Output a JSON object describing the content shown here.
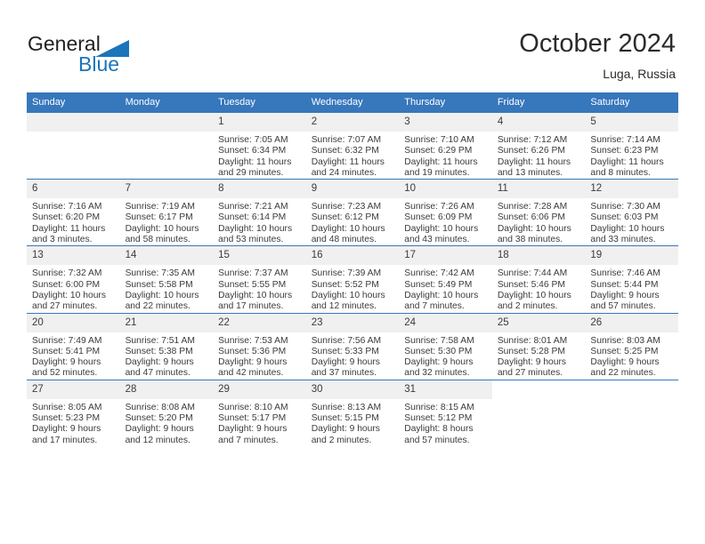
{
  "brand": {
    "name_part1": "General",
    "name_part2": "Blue",
    "accent_color": "#1b75bb"
  },
  "header": {
    "month_title": "October 2024",
    "location": "Luga, Russia"
  },
  "colors": {
    "header_blue": "#3777bc",
    "daynum_band": "#f0f0f0",
    "text": "#3b3b3b"
  },
  "weekdays": [
    "Sunday",
    "Monday",
    "Tuesday",
    "Wednesday",
    "Thursday",
    "Friday",
    "Saturday"
  ],
  "weeks": [
    [
      {
        "day": "",
        "blank": true
      },
      {
        "day": "",
        "blank": true
      },
      {
        "day": "1",
        "sunrise": "Sunrise: 7:05 AM",
        "sunset": "Sunset: 6:34 PM",
        "daylight1": "Daylight: 11 hours",
        "daylight2": "and 29 minutes."
      },
      {
        "day": "2",
        "sunrise": "Sunrise: 7:07 AM",
        "sunset": "Sunset: 6:32 PM",
        "daylight1": "Daylight: 11 hours",
        "daylight2": "and 24 minutes."
      },
      {
        "day": "3",
        "sunrise": "Sunrise: 7:10 AM",
        "sunset": "Sunset: 6:29 PM",
        "daylight1": "Daylight: 11 hours",
        "daylight2": "and 19 minutes."
      },
      {
        "day": "4",
        "sunrise": "Sunrise: 7:12 AM",
        "sunset": "Sunset: 6:26 PM",
        "daylight1": "Daylight: 11 hours",
        "daylight2": "and 13 minutes."
      },
      {
        "day": "5",
        "sunrise": "Sunrise: 7:14 AM",
        "sunset": "Sunset: 6:23 PM",
        "daylight1": "Daylight: 11 hours",
        "daylight2": "and 8 minutes."
      }
    ],
    [
      {
        "day": "6",
        "sunrise": "Sunrise: 7:16 AM",
        "sunset": "Sunset: 6:20 PM",
        "daylight1": "Daylight: 11 hours",
        "daylight2": "and 3 minutes."
      },
      {
        "day": "7",
        "sunrise": "Sunrise: 7:19 AM",
        "sunset": "Sunset: 6:17 PM",
        "daylight1": "Daylight: 10 hours",
        "daylight2": "and 58 minutes."
      },
      {
        "day": "8",
        "sunrise": "Sunrise: 7:21 AM",
        "sunset": "Sunset: 6:14 PM",
        "daylight1": "Daylight: 10 hours",
        "daylight2": "and 53 minutes."
      },
      {
        "day": "9",
        "sunrise": "Sunrise: 7:23 AM",
        "sunset": "Sunset: 6:12 PM",
        "daylight1": "Daylight: 10 hours",
        "daylight2": "and 48 minutes."
      },
      {
        "day": "10",
        "sunrise": "Sunrise: 7:26 AM",
        "sunset": "Sunset: 6:09 PM",
        "daylight1": "Daylight: 10 hours",
        "daylight2": "and 43 minutes."
      },
      {
        "day": "11",
        "sunrise": "Sunrise: 7:28 AM",
        "sunset": "Sunset: 6:06 PM",
        "daylight1": "Daylight: 10 hours",
        "daylight2": "and 38 minutes."
      },
      {
        "day": "12",
        "sunrise": "Sunrise: 7:30 AM",
        "sunset": "Sunset: 6:03 PM",
        "daylight1": "Daylight: 10 hours",
        "daylight2": "and 33 minutes."
      }
    ],
    [
      {
        "day": "13",
        "sunrise": "Sunrise: 7:32 AM",
        "sunset": "Sunset: 6:00 PM",
        "daylight1": "Daylight: 10 hours",
        "daylight2": "and 27 minutes."
      },
      {
        "day": "14",
        "sunrise": "Sunrise: 7:35 AM",
        "sunset": "Sunset: 5:58 PM",
        "daylight1": "Daylight: 10 hours",
        "daylight2": "and 22 minutes."
      },
      {
        "day": "15",
        "sunrise": "Sunrise: 7:37 AM",
        "sunset": "Sunset: 5:55 PM",
        "daylight1": "Daylight: 10 hours",
        "daylight2": "and 17 minutes."
      },
      {
        "day": "16",
        "sunrise": "Sunrise: 7:39 AM",
        "sunset": "Sunset: 5:52 PM",
        "daylight1": "Daylight: 10 hours",
        "daylight2": "and 12 minutes."
      },
      {
        "day": "17",
        "sunrise": "Sunrise: 7:42 AM",
        "sunset": "Sunset: 5:49 PM",
        "daylight1": "Daylight: 10 hours",
        "daylight2": "and 7 minutes."
      },
      {
        "day": "18",
        "sunrise": "Sunrise: 7:44 AM",
        "sunset": "Sunset: 5:46 PM",
        "daylight1": "Daylight: 10 hours",
        "daylight2": "and 2 minutes."
      },
      {
        "day": "19",
        "sunrise": "Sunrise: 7:46 AM",
        "sunset": "Sunset: 5:44 PM",
        "daylight1": "Daylight: 9 hours",
        "daylight2": "and 57 minutes."
      }
    ],
    [
      {
        "day": "20",
        "sunrise": "Sunrise: 7:49 AM",
        "sunset": "Sunset: 5:41 PM",
        "daylight1": "Daylight: 9 hours",
        "daylight2": "and 52 minutes."
      },
      {
        "day": "21",
        "sunrise": "Sunrise: 7:51 AM",
        "sunset": "Sunset: 5:38 PM",
        "daylight1": "Daylight: 9 hours",
        "daylight2": "and 47 minutes."
      },
      {
        "day": "22",
        "sunrise": "Sunrise: 7:53 AM",
        "sunset": "Sunset: 5:36 PM",
        "daylight1": "Daylight: 9 hours",
        "daylight2": "and 42 minutes."
      },
      {
        "day": "23",
        "sunrise": "Sunrise: 7:56 AM",
        "sunset": "Sunset: 5:33 PM",
        "daylight1": "Daylight: 9 hours",
        "daylight2": "and 37 minutes."
      },
      {
        "day": "24",
        "sunrise": "Sunrise: 7:58 AM",
        "sunset": "Sunset: 5:30 PM",
        "daylight1": "Daylight: 9 hours",
        "daylight2": "and 32 minutes."
      },
      {
        "day": "25",
        "sunrise": "Sunrise: 8:01 AM",
        "sunset": "Sunset: 5:28 PM",
        "daylight1": "Daylight: 9 hours",
        "daylight2": "and 27 minutes."
      },
      {
        "day": "26",
        "sunrise": "Sunrise: 8:03 AM",
        "sunset": "Sunset: 5:25 PM",
        "daylight1": "Daylight: 9 hours",
        "daylight2": "and 22 minutes."
      }
    ],
    [
      {
        "day": "27",
        "sunrise": "Sunrise: 8:05 AM",
        "sunset": "Sunset: 5:23 PM",
        "daylight1": "Daylight: 9 hours",
        "daylight2": "and 17 minutes."
      },
      {
        "day": "28",
        "sunrise": "Sunrise: 8:08 AM",
        "sunset": "Sunset: 5:20 PM",
        "daylight1": "Daylight: 9 hours",
        "daylight2": "and 12 minutes."
      },
      {
        "day": "29",
        "sunrise": "Sunrise: 8:10 AM",
        "sunset": "Sunset: 5:17 PM",
        "daylight1": "Daylight: 9 hours",
        "daylight2": "and 7 minutes."
      },
      {
        "day": "30",
        "sunrise": "Sunrise: 8:13 AM",
        "sunset": "Sunset: 5:15 PM",
        "daylight1": "Daylight: 9 hours",
        "daylight2": "and 2 minutes."
      },
      {
        "day": "31",
        "sunrise": "Sunrise: 8:15 AM",
        "sunset": "Sunset: 5:12 PM",
        "daylight1": "Daylight: 8 hours",
        "daylight2": "and 57 minutes."
      },
      {
        "day": "",
        "noday": true
      },
      {
        "day": "",
        "noday": true
      }
    ]
  ]
}
